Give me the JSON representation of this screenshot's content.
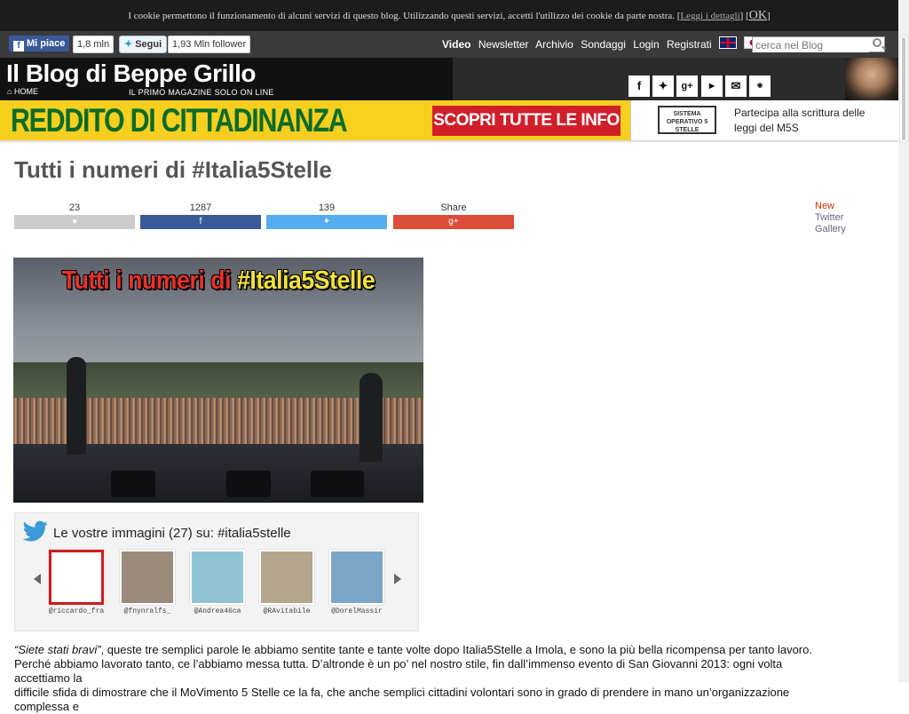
{
  "cookie": {
    "text": "I cookie permettono il funzionamento di alcuni servizi di questo blog. Utilizzando questi servizi, accetti l'utilizzo dei cookie da parte nostra.",
    "link": "Leggi i dettagli",
    "ok": "OK"
  },
  "topbar": {
    "fb_label": "Mi piace",
    "fb_count": "1,8 mln",
    "tw_label": "Segui",
    "tw_count": "1,93 Mln follower",
    "nav": [
      "Video",
      "Newsletter",
      "Archivio",
      "Sondaggi",
      "Login",
      "Registrati"
    ],
    "search_placeholder": "cerca nel Blog"
  },
  "header": {
    "logo": "Il Blog di Beppe Grillo",
    "home": "HOME",
    "tagline": "IL PRIMO MAGAZINE SOLO ON LINE",
    "social_icons": [
      "facebook-icon",
      "twitter-icon",
      "google-plus-icon",
      "youtube-icon",
      "email-icon",
      "meetup-icon"
    ]
  },
  "banner": {
    "title": "REDDITO DI CITTADINANZA",
    "cta": "SCOPRI TUTTE LE INFO",
    "sys_badge": "SISTEMA OPERATIVO 5 STELLE",
    "text_line1": "Partecipa alla scrittura delle",
    "text_line2": "leggi del M5S"
  },
  "article": {
    "title": "Tutti i numeri di #Italia5Stelle",
    "share": [
      {
        "count": "23",
        "color": "#cccccc",
        "icon": "comment-icon",
        "glyph": "●"
      },
      {
        "count": "1287",
        "color": "#3b5998",
        "icon": "facebook-icon",
        "glyph": "f"
      },
      {
        "count": "139",
        "color": "#55acee",
        "icon": "twitter-icon",
        "glyph": "✦"
      },
      {
        "count": "Share",
        "color": "#dd4b39",
        "icon": "google-plus-icon",
        "glyph": "g+"
      }
    ],
    "side_links": [
      "New",
      "Twitter",
      "Gallery"
    ],
    "hero_headline_part1": "Tutti i numeri di ",
    "hero_headline_part2": "#Italia5Stelle"
  },
  "twitter_widget": {
    "title": "Le vostre immagini (27) su: #italia5stelle",
    "thumbs": [
      {
        "handle": "@riccardo_fra",
        "bg": "#ffffff"
      },
      {
        "handle": "@fnynralfs_",
        "bg": "#9c8a7a"
      },
      {
        "handle": "@Andrea46ca",
        "bg": "#8fc3d4"
      },
      {
        "handle": "@RAvitabile",
        "bg": "#b5a58c"
      },
      {
        "handle": "@DorelMassir",
        "bg": "#7aa6c8"
      }
    ]
  },
  "body": {
    "line1_italic": "“Siete stati bravi”",
    "line1_rest": ", queste tre semplici parole le abbiamo sentite tante e tante volte dopo Italia5Stelle a Imola, e sono la più bella ricompensa per tanto lavoro.",
    "line2": "Perché abbiamo lavorato tanto, ce l’abbiamo messa tutta. D’altronde è un po’ nel nostro stile, fin dall’immenso evento di San Giovanni 2013: ogni volta accettiamo la",
    "line3": "difficile sfida di dimostrare che il MoVimento 5 Stelle ce la fa, che anche semplici cittadini volontari sono in grado di prendere in mano un’organizzazione complessa e"
  }
}
